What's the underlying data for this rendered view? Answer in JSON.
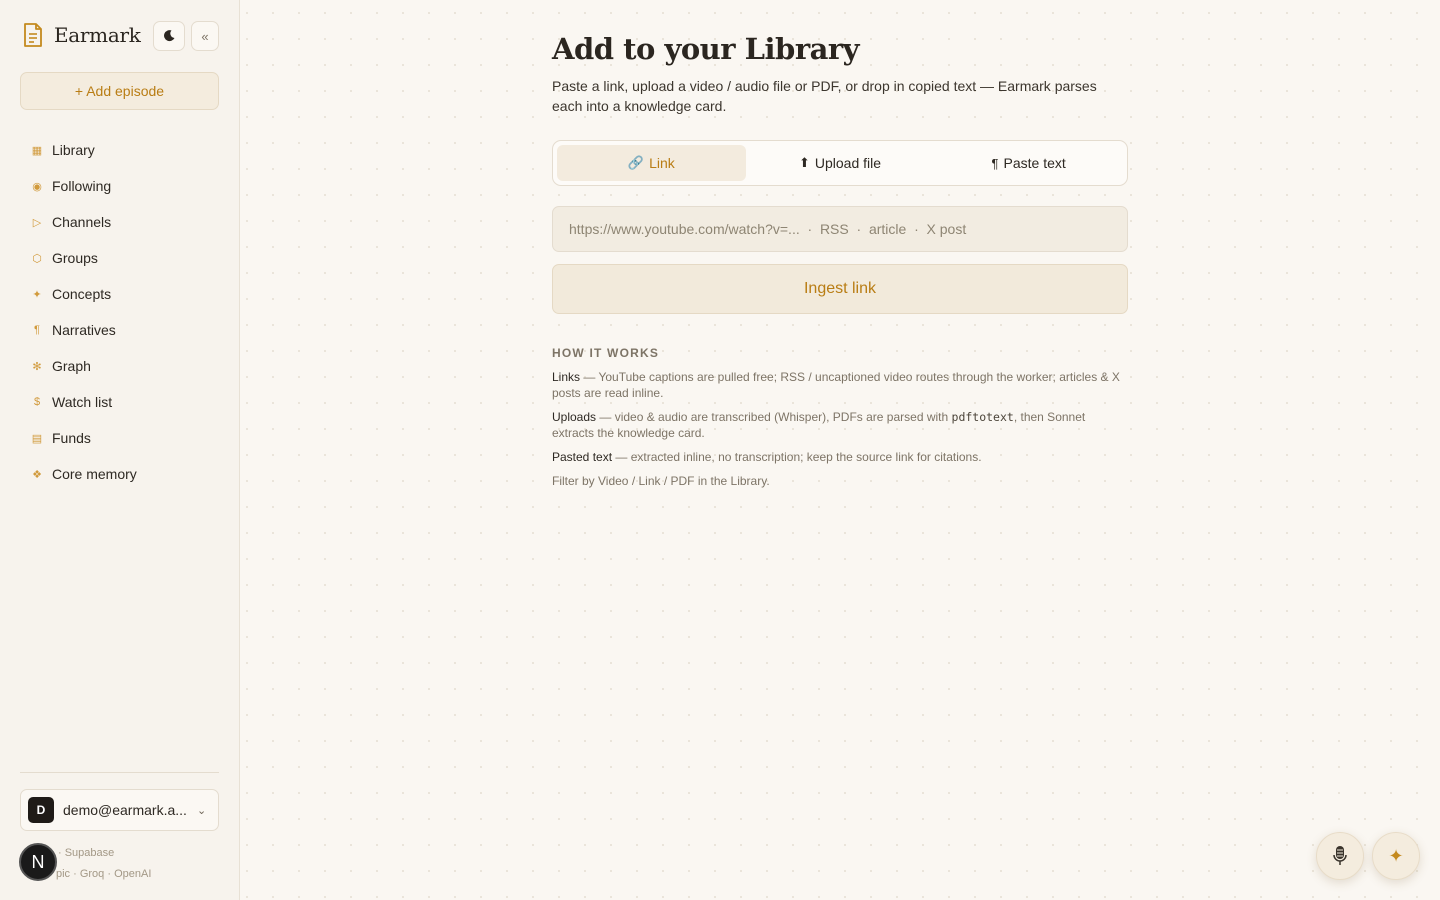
{
  "app": {
    "name": "Earmark"
  },
  "sidebar": {
    "add_episode_label": "+ Add episode",
    "collapse_label": "«",
    "items": [
      {
        "label": "Library",
        "icon": "grid-icon"
      },
      {
        "label": "Following",
        "icon": "radio-icon"
      },
      {
        "label": "Channels",
        "icon": "play-icon"
      },
      {
        "label": "Groups",
        "icon": "hexagon-icon"
      },
      {
        "label": "Concepts",
        "icon": "sparkle-icon"
      },
      {
        "label": "Narratives",
        "icon": "pilcrow-icon"
      },
      {
        "label": "Graph",
        "icon": "asterisk-icon"
      },
      {
        "label": "Watch list",
        "icon": "dollar-icon"
      },
      {
        "label": "Funds",
        "icon": "list-icon"
      },
      {
        "label": "Core memory",
        "icon": "diamond-cluster-icon"
      }
    ],
    "account": {
      "avatar_letter": "D",
      "email": "demo@earmark.a..."
    },
    "providers_line1": "· Supabase",
    "providers_line2": "pic · Groq · OpenAI",
    "overlay_avatar": "N"
  },
  "main": {
    "title": "Add to your Library",
    "subtitle": "Paste a link, upload a video / audio file or PDF, or drop in copied text — Earmark parses each into a knowledge card.",
    "tabs": [
      {
        "label": "Link",
        "icon": "🔗",
        "active": true
      },
      {
        "label": "Upload file",
        "icon": "⬆",
        "active": false
      },
      {
        "label": "Paste text",
        "icon": "¶",
        "active": false
      }
    ],
    "url_placeholder": "https://www.youtube.com/watch?v=...  ·  RSS  ·  article  ·  X post",
    "ingest_label": "Ingest link",
    "how_it_works": {
      "heading": "HOW IT WORKS",
      "links_term": "Links",
      "links_text": " — YouTube captions are pulled free; RSS / uncaptioned video routes through the worker; articles & X posts are read inline.",
      "uploads_term": "Uploads",
      "uploads_text_a": " — video & audio are transcribed (Whisper), PDFs are parsed with ",
      "uploads_code": "pdftotext",
      "uploads_text_b": ", then Sonnet extracts the knowledge card.",
      "pasted_term": "Pasted text",
      "pasted_text": " — extracted inline, no transcription; keep the source link for citations.",
      "filter_note": "Filter by Video / Link / PDF in the Library."
    }
  },
  "colors": {
    "accent": "#b97d14",
    "background": "#faf7f2",
    "sidebar": "#f7f3ed"
  }
}
